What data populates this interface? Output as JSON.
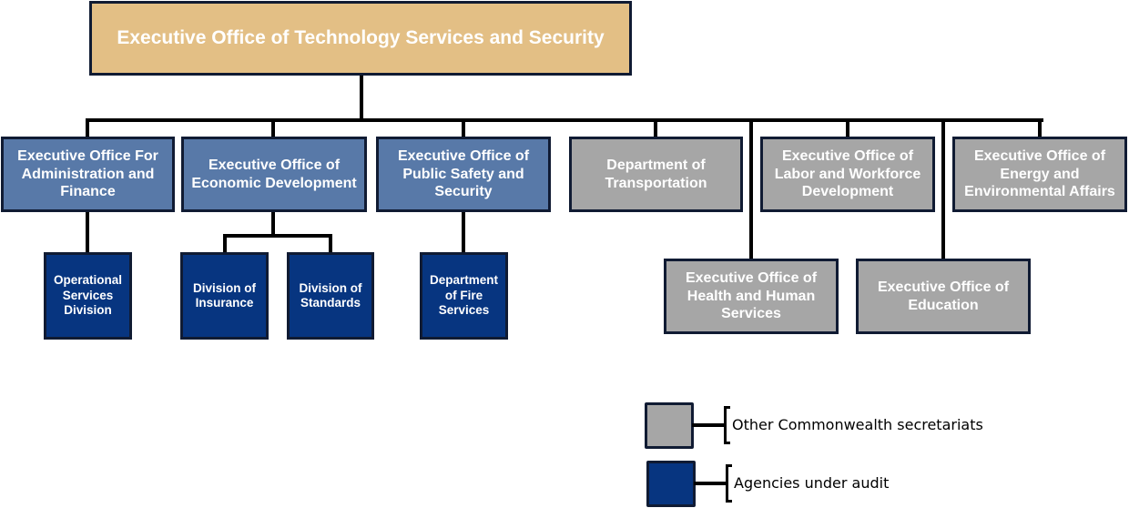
{
  "root": {
    "label": "Executive Office of Technology Services and Security"
  },
  "secretariats": [
    {
      "label": "Executive Office For Administration and Finance",
      "category": "audit-parent"
    },
    {
      "label": "Executive Office of Economic Development",
      "category": "audit-parent"
    },
    {
      "label": "Executive Office of Public Safety and Security",
      "category": "audit-parent"
    },
    {
      "label": "Department of Transportation",
      "category": "other"
    },
    {
      "label": "Executive Office of Labor and Workforce Development",
      "category": "other"
    },
    {
      "label": "Executive Office of Energy and Environmental Affairs",
      "category": "other"
    },
    {
      "label": "Executive Office of Health and Human Services",
      "category": "other"
    },
    {
      "label": "Executive Office of Education",
      "category": "other"
    }
  ],
  "agencies": [
    {
      "label": "Operational Services Division",
      "parent": "Executive Office For Administration and Finance"
    },
    {
      "label": "Division of Insurance",
      "parent": "Executive Office of Economic Development"
    },
    {
      "label": "Division of Standards",
      "parent": "Executive Office of Economic Development"
    },
    {
      "label": "Department of Fire Services",
      "parent": "Executive Office of Public Safety and Security"
    }
  ],
  "legend": [
    {
      "label": "Other Commonwealth secretariats",
      "color": "#a6a6a6"
    },
    {
      "label": "Agencies under audit",
      "color": "#073580"
    }
  ],
  "colors": {
    "root": "#e3bf85",
    "audit_parent": "#5879a8",
    "other": "#a6a6a6",
    "agency": "#073580",
    "border": "#101b33"
  }
}
